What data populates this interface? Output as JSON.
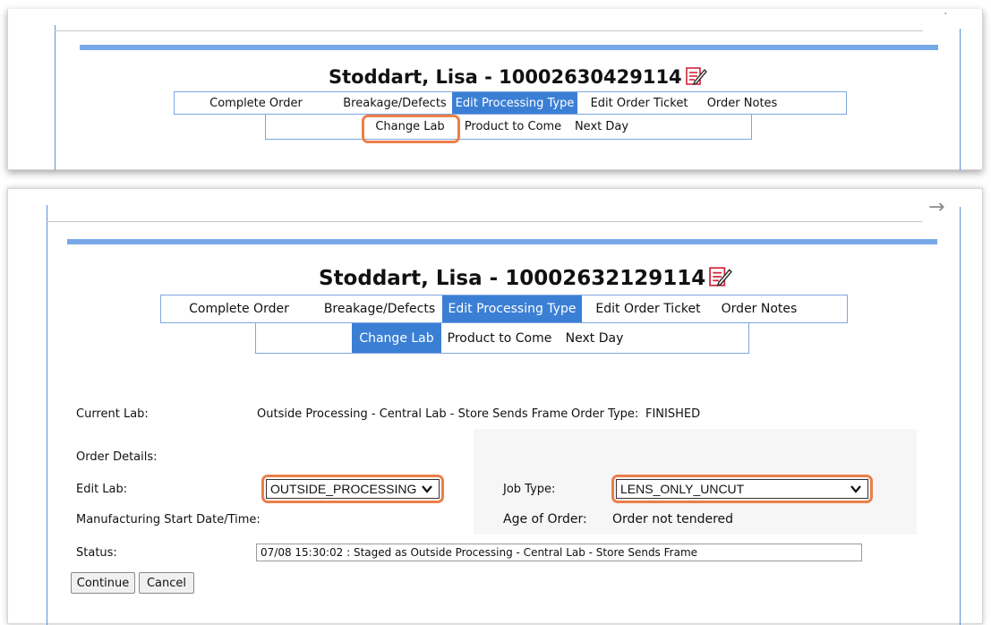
{
  "top": {
    "title": "Stoddart, Lisa - 10002630429114",
    "menu": [
      "Complete Order",
      "Breakage/Defects",
      "Edit Processing Type",
      "Edit Order Ticket",
      "Order Notes"
    ],
    "submenu": [
      "Change Lab",
      "Product to Come",
      "Next Day"
    ],
    "active_menu": "Edit Processing Type",
    "highlighted_submenu": "Change Lab"
  },
  "bottom": {
    "title": "Stoddart, Lisa - 10002632129114",
    "menu": [
      "Complete Order",
      "Breakage/Defects",
      "Edit Processing Type",
      "Edit Order Ticket",
      "Order Notes"
    ],
    "submenu": [
      "Change Lab",
      "Product to Come",
      "Next Day"
    ],
    "active_menu": "Edit Processing Type",
    "active_submenu": "Change Lab",
    "form": {
      "current_lab_label": "Current Lab:",
      "current_lab_value": "Outside Processing - Central Lab - Store Sends Frame",
      "order_type_label": "Order Type:",
      "order_type_value": "FINISHED",
      "order_details_label": "Order Details:",
      "edit_lab_label": "Edit Lab:",
      "edit_lab_value": "OUTSIDE_PROCESSING",
      "job_type_label": "Job Type:",
      "job_type_value": "LENS_ONLY_UNCUT",
      "mfg_start_label": "Manufacturing Start Date/Time:",
      "age_label": "Age of Order:",
      "age_value": "Order not tendered",
      "status_label": "Status:",
      "status_value": "07/08 15:30:02 : Staged as Outside Processing - Central Lab - Store Sends Frame",
      "continue_label": "Continue",
      "cancel_label": "Cancel"
    }
  },
  "colors": {
    "accent_blue": "#3b7fd5",
    "highlight_orange": "#ec7f4a",
    "icon_red": "#d0243a"
  }
}
